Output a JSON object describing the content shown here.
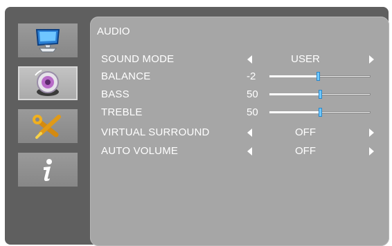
{
  "sidebar": {
    "items": [
      {
        "name": "picture",
        "icon": "monitor-icon",
        "active": false
      },
      {
        "name": "audio",
        "icon": "speaker-icon",
        "active": true
      },
      {
        "name": "setup",
        "icon": "wrench-screwdriver-icon",
        "active": false
      },
      {
        "name": "information",
        "icon": "info-icon",
        "active": false
      }
    ]
  },
  "panel": {
    "title": "AUDIO",
    "settings": [
      {
        "label": "SOUND MODE",
        "type": "selector",
        "value": "USER"
      },
      {
        "label": "BALANCE",
        "type": "slider",
        "value": "-2",
        "level": 0.48
      },
      {
        "label": "BASS",
        "type": "slider",
        "value": "50",
        "level": 0.5
      },
      {
        "label": "TREBLE",
        "type": "slider",
        "value": "50",
        "level": 0.5
      },
      {
        "label": "VIRTUAL SURROUND",
        "type": "selector",
        "value": "OFF"
      },
      {
        "label": "AUTO VOLUME",
        "type": "selector",
        "value": "OFF"
      }
    ]
  },
  "colors": {
    "osd_background": "#5f5f5f",
    "panel_background": "#a6a6a6",
    "text": "#ffffff",
    "slider_knob": "#6ec8ff"
  }
}
